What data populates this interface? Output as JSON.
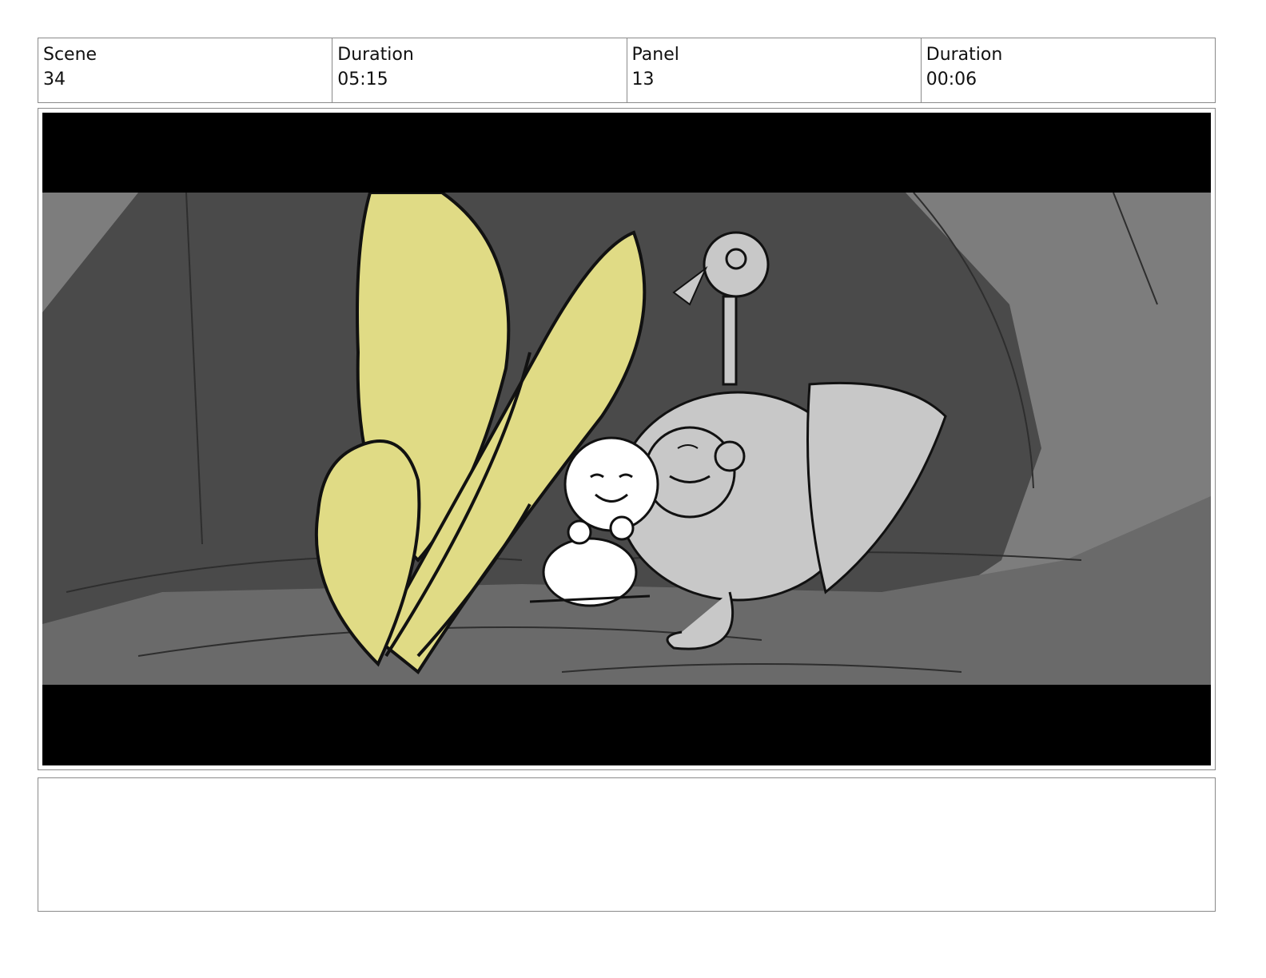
{
  "header": {
    "cells": [
      {
        "label": "Scene",
        "value": "34"
      },
      {
        "label": "Duration",
        "value": "05:15"
      },
      {
        "label": "Panel",
        "value": "13"
      },
      {
        "label": "Duration",
        "value": "00:06"
      }
    ]
  },
  "panel": {
    "colors": {
      "letterbox": "#000000",
      "cave_dark": "#4a4a4a",
      "cave_light": "#7d7d7d",
      "leaf": "#e0db85",
      "creature": "#c8c8c8",
      "child": "#ffffff"
    }
  },
  "notes": {
    "text": ""
  }
}
